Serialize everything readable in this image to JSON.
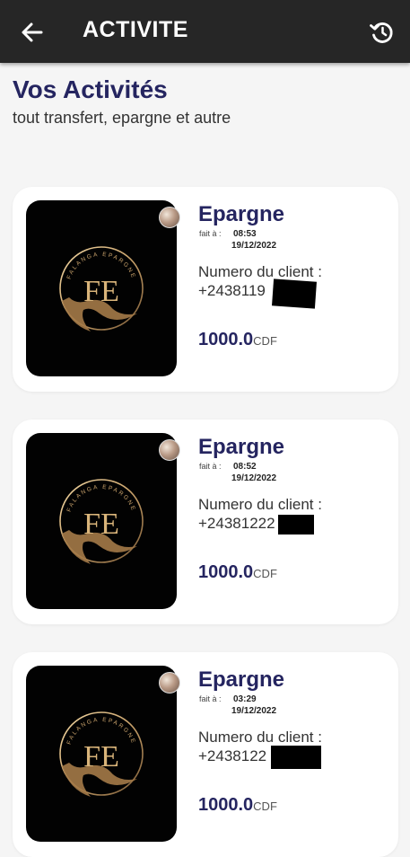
{
  "appbar": {
    "title": "ACTIVITE",
    "back_icon": "arrow-left-icon",
    "refresh_icon": "history-refresh-icon",
    "background": "#262626"
  },
  "header": {
    "title": "Vos Activités",
    "subtitle": "tout transfert, epargne et autre"
  },
  "colors": {
    "accent": "#252560",
    "gold": "#c9a26b",
    "page_bg": "#f5f5f5",
    "card_bg": "#ffffff"
  },
  "activities": [
    {
      "type": "Epargne",
      "fait_label": "fait à :",
      "time": "08:53",
      "date": "19/12/2022",
      "client_label": "Numero du client :",
      "client_number": "+2438119",
      "amount": "1000.0",
      "currency": "CDF",
      "logo_text": "FALANGA EPARGNE",
      "logo_monogram": "FE"
    },
    {
      "type": "Epargne",
      "fait_label": "fait à :",
      "time": "08:52",
      "date": "19/12/2022",
      "client_label": "Numero du client :",
      "client_number": "+24381222",
      "amount": "1000.0",
      "currency": "CDF",
      "logo_text": "FALANGA EPARGNE",
      "logo_monogram": "FE"
    },
    {
      "type": "Epargne",
      "fait_label": "fait à :",
      "time": "03:29",
      "date": "19/12/2022",
      "client_label": "Numero du client :",
      "client_number": "+2438122",
      "amount": "1000.0",
      "currency": "CDF",
      "logo_text": "FALANGA EPARGNE",
      "logo_monogram": "FE"
    }
  ]
}
